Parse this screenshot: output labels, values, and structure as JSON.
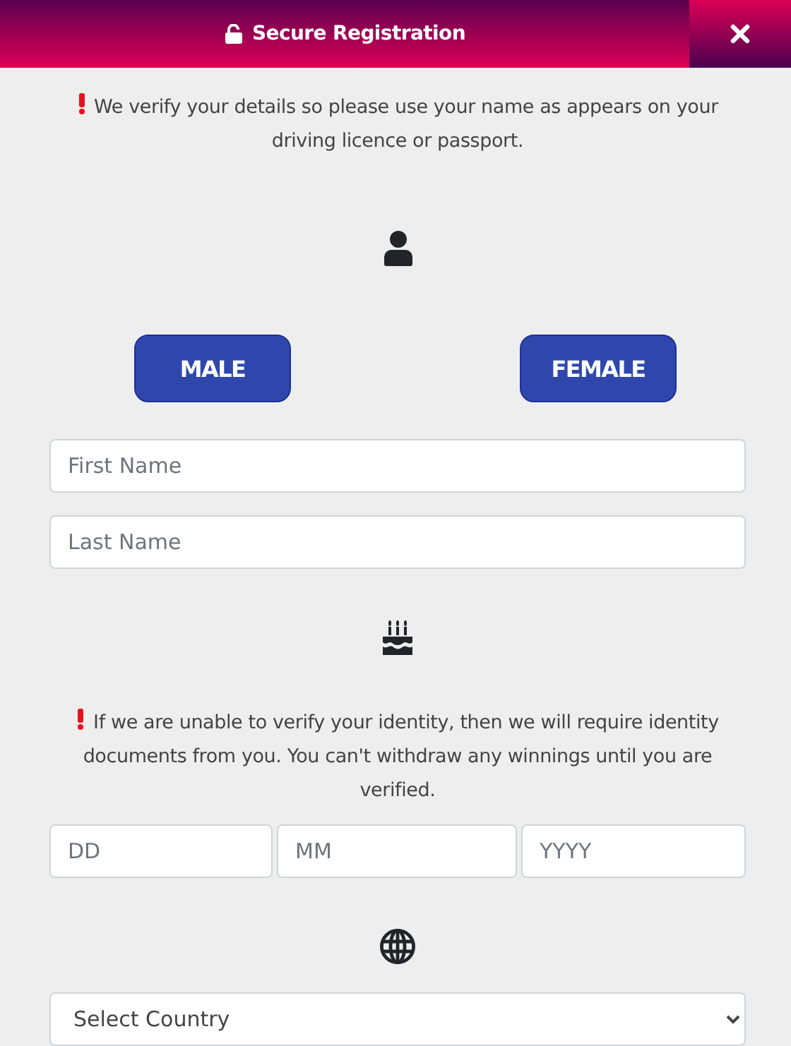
{
  "header": {
    "title": "Secure Registration"
  },
  "notices": [
    "We verify your details so please use your name as appears on your driving licence or passport.",
    "If we are unable to verify your identity, then we will require identity documents from you. You can't withdraw any winnings until you are verified."
  ],
  "gender_buttons": [
    "MALE",
    "FEMALE"
  ],
  "name_fields": [
    {
      "placeholder": "First Name"
    },
    {
      "placeholder": "Last Name"
    }
  ],
  "date_fields": [
    {
      "placeholder": "DD"
    },
    {
      "placeholder": "MM"
    },
    {
      "placeholder": "YYYY"
    }
  ],
  "country_select": {
    "value": "Select Country"
  }
}
